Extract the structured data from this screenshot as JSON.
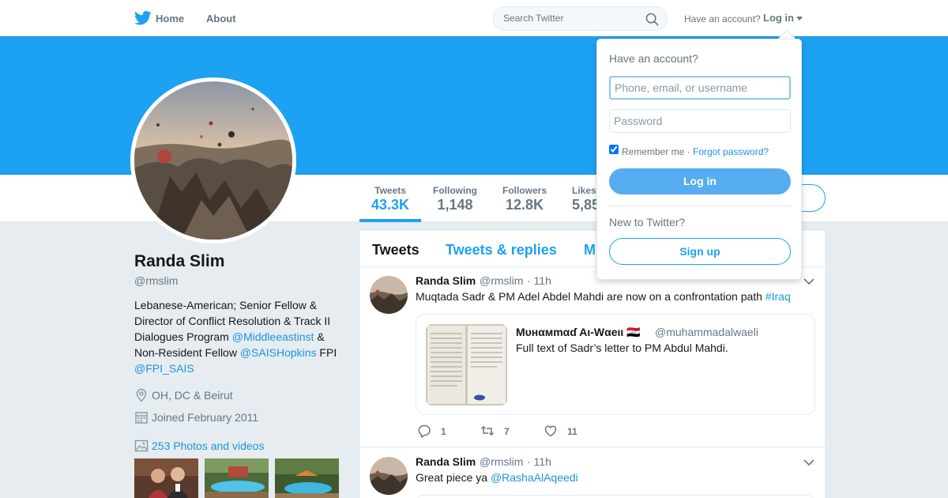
{
  "topnav": {
    "logo_icon": "twitter-bird-icon",
    "home_label": "Home",
    "about_label": "About",
    "search_placeholder": "Search Twitter",
    "have_account": "Have an account?",
    "login_label": "Log in"
  },
  "colors": {
    "brand": "#1da1f2",
    "link": "#1b95e0",
    "login_button": "#55acee"
  },
  "profile_nav": {
    "stats": [
      {
        "label": "Tweets",
        "value": "43.3K",
        "active": true
      },
      {
        "label": "Following",
        "value": "1,148"
      },
      {
        "label": "Followers",
        "value": "12.8K"
      },
      {
        "label": "Likes",
        "value": "5,85"
      }
    ]
  },
  "profile": {
    "name": "Randa Slim",
    "handle": "@rmslim",
    "bio_1": "Lebanese-American; Senior Fellow & Director of Conflict Resolution & Track II Dialogues Program ",
    "bio_link_1": "@Middleeastinst",
    "bio_2": " & Non-Resident Fellow ",
    "bio_link_2": "@SAISHopkins",
    "bio_3": " FPI ",
    "bio_link_3": "@FPI_SAIS",
    "location": "OH, DC & Beirut",
    "joined": "Joined February 2011",
    "photos": "253 Photos and videos"
  },
  "timeline": {
    "tabs": [
      "Tweets",
      "Tweets & replies",
      "M"
    ],
    "tweets": [
      {
        "name": "Randa Slim",
        "handle": "@rmslim",
        "time": "· 11h",
        "text": "Muqtada Sadr & PM Adel Abdel Mahdi are now on a confrontation path ",
        "hashtag": "#Iraq",
        "quote": {
          "name": "Mυнαмmαɗ Aι-Wαeιι 🇮🇶",
          "handle": "@muhammadalwaeli",
          "text": "Full text of Sadr’s letter to PM Abdul Mahdi."
        },
        "replies": "1",
        "retweets": "7",
        "likes": "11"
      },
      {
        "name": "Randa Slim",
        "handle": "@rmslim",
        "time": "· 11h",
        "text": "Great piece ya ",
        "mention": "@RashaAlAqeedi"
      }
    ]
  },
  "login_dropdown": {
    "title": "Have an account?",
    "username_placeholder": "Phone, email, or username",
    "password_placeholder": "Password",
    "remember_me": "Remember me",
    "separator": " · ",
    "forgot_password": "Forgot password?",
    "login_button": "Log in",
    "new_to_twitter": "New to Twitter?",
    "signup_button": "Sign up"
  }
}
